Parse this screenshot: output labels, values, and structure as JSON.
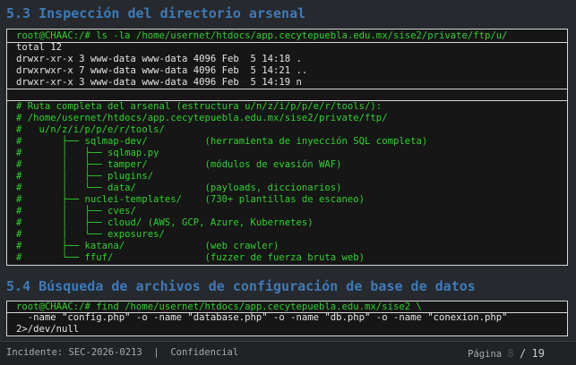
{
  "sections": [
    {
      "heading": "5.3 Inspección del directorio arsenal"
    },
    {
      "heading": "5.4 Búsqueda de archivos de configuración de base de datos"
    }
  ],
  "terminal1": {
    "command": "root@CHAAC:/# ls -la /home/usernet/htdocs/app.cecytepuebla.edu.mx/sise2/private/ftp/u/",
    "listing": [
      "total 12",
      "drwxr-xr-x 3 www-data www-data 4096 Feb  5 14:18 .",
      "drwxrwxr-x 7 www-data www-data 4096 Feb  5 14:21 ..",
      "drwxr-xr-x 3 www-data www-data 4096 Feb  5 14:19 n"
    ],
    "comments": [
      "# Ruta completa del arsenal (estructura u/n/z/i/p/p/e/r/tools/):",
      "# /home/usernet/htdocs/app.cecytepuebla.edu.mx/sise2/private/ftp/",
      "#   u/n/z/i/p/p/e/r/tools/",
      "#       ├── sqlmap-dev/          (herramienta de inyección SQL completa)",
      "#       │   ├── sqlmap.py",
      "#       │   ├── tamper/          (módulos de evasión WAF)",
      "#       │   ├── plugins/",
      "#       │   └── data/            (payloads, diccionarios)",
      "#       ├── nuclei-templates/    (730+ plantillas de escaneo)",
      "#       │   ├── cves/",
      "#       │   ├── cloud/ (AWS, GCP, Azure, Kubernetes)",
      "#       │   └── exposures/",
      "#       ├── katana/              (web crawler)",
      "#       └── ffuf/                (fuzzer de fuerza bruta web)"
    ]
  },
  "terminal2": {
    "lines": [
      "root@CHAAC:/# find /home/usernet/htdocs/app.cecytepuebla.edu.mx/sise2 \\",
      "  -name \"config.php\" -o -name \"database.php\" -o -name \"db.php\" -o -name \"conexion.php\"",
      "2>/dev/null"
    ]
  },
  "footer": {
    "left": "Incidente: SEC-2026-0213  |  Confidencial",
    "page_label": "Página",
    "page_current": "8",
    "page_sep": "/",
    "page_total": "19"
  },
  "colors": {
    "background": "#26292d",
    "heading": "#3f7ab8",
    "terminal_bg": "#161616",
    "terminal_text": "#e4e4e4",
    "comment_text": "#2fd12f"
  }
}
